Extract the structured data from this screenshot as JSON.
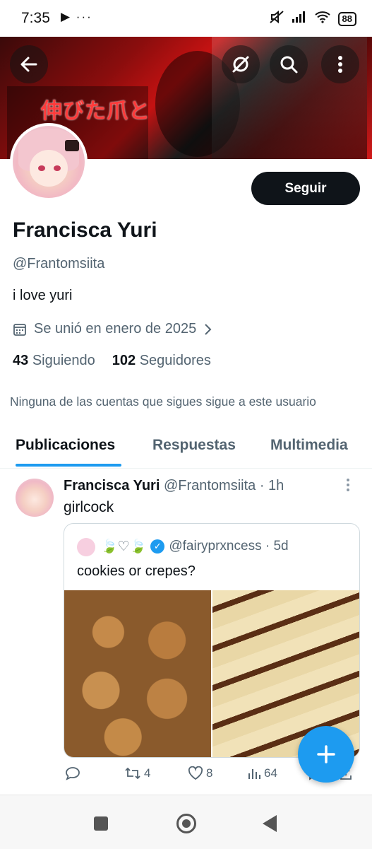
{
  "status": {
    "time": "7:35",
    "left_icons": "▶ ···",
    "battery": "88"
  },
  "banner": {
    "text": "伸びた爪と"
  },
  "profile": {
    "name": "Francisca Yuri",
    "handle": "@Frantomsiita",
    "bio": "i love yuri",
    "joined": "Se unió en enero de 2025",
    "following_count": "43",
    "following_label": "Siguiendo",
    "followers_count": "102",
    "followers_label": "Seguidores",
    "mutual_text": "Ninguna de las cuentas que sigues sigue a este usuario",
    "follow_button": "Seguir"
  },
  "tabs": [
    {
      "label": "Publicaciones",
      "active": true
    },
    {
      "label": "Respuestas",
      "active": false
    },
    {
      "label": "Multimedia",
      "active": false
    }
  ],
  "post": {
    "name": "Francisca Yuri",
    "meta": "@Frantomsiita · 1h",
    "text": "girlcock",
    "quote": {
      "emoji": "🍃♡🍃",
      "meta": "@fairyprxncess · 5d",
      "text": "cookies or crepes?"
    },
    "retweets": "4",
    "likes": "8",
    "views": "64"
  },
  "colors": {
    "accent": "#1d9bf0",
    "text": "#0f1419",
    "muted": "#536471"
  }
}
